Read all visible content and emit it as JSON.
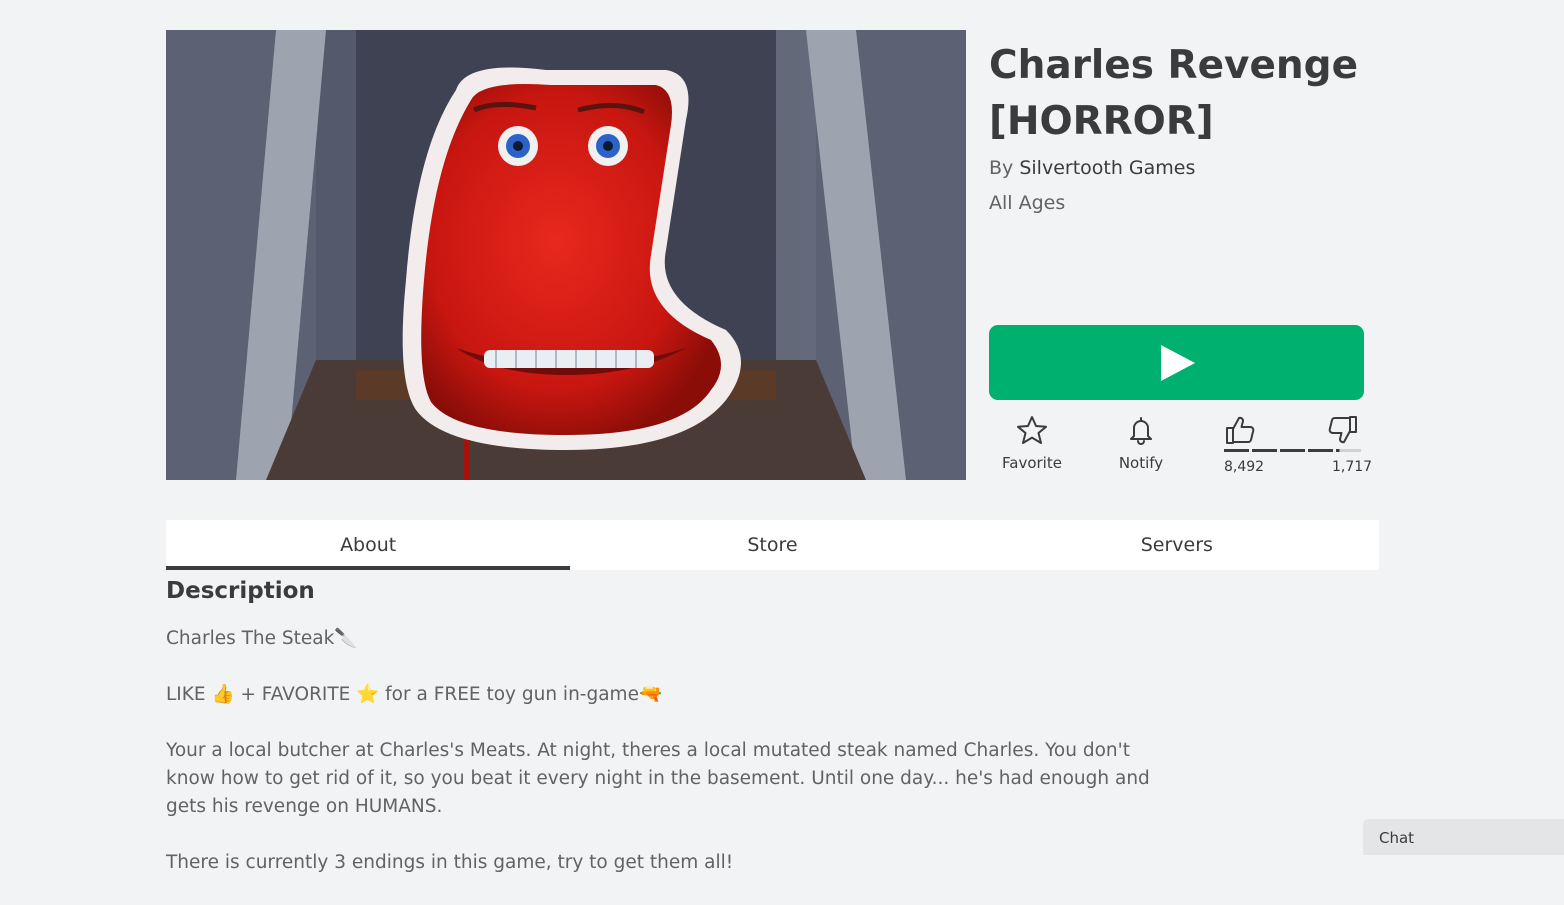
{
  "game": {
    "title": "Charles Revenge [HORROR]",
    "by_prefix": "By ",
    "creator": "Silvertooth Games",
    "age_rating": "All Ages"
  },
  "thumbnail": {
    "alt": "Charles the steak character"
  },
  "actions": {
    "favorite_label": "Favorite",
    "notify_label": "Notify",
    "upvotes": "8,492",
    "downvotes": "1,717",
    "upvote_fraction": 0.83
  },
  "tabs": [
    {
      "label": "About",
      "active": true
    },
    {
      "label": "Store",
      "active": false
    },
    {
      "label": "Servers",
      "active": false
    }
  ],
  "description": {
    "heading": "Description",
    "paragraphs": [
      "Charles The Steak🔪",
      "LIKE 👍 + FAVORITE ⭐ for a FREE toy gun in-game🔫",
      "Your a local butcher at Charles's Meats. At night, theres a local mutated steak named Charles. You don't know how to get rid of it, so you beat it every night in the basement. Until one day... he's had enough and gets his revenge on HUMANS.",
      "There is currently 3 endings in this game, try to get them all!"
    ]
  },
  "chat": {
    "label": "Chat"
  },
  "colors": {
    "play": "#00b06f",
    "text": "#393b3d",
    "muted": "#606264"
  },
  "icons": [
    "play-icon",
    "star-icon",
    "bell-icon",
    "thumbs-up-icon",
    "thumbs-down-icon"
  ]
}
